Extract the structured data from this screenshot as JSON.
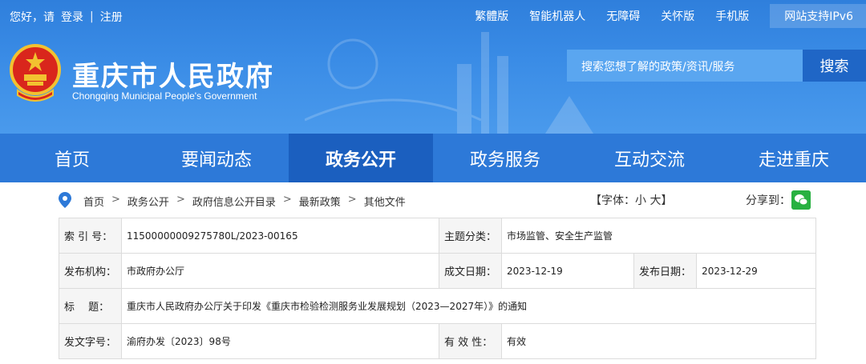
{
  "topbar": {
    "greeting": "您好，请",
    "login": "登录",
    "separator": "|",
    "register": "注册",
    "links": [
      "繁體版",
      "智能机器人",
      "无障碍",
      "关怀版",
      "手机版"
    ],
    "ipv6": "网站支持IPv6"
  },
  "header": {
    "title": "重庆市人民政府",
    "subtitle": "Chongqing Municipal People's Government",
    "search_placeholder": "搜索您想了解的政策/资讯/服务",
    "search_button": "搜索"
  },
  "nav": [
    {
      "label": "首页",
      "active": false
    },
    {
      "label": "要闻动态",
      "active": false
    },
    {
      "label": "政务公开",
      "active": true
    },
    {
      "label": "政务服务",
      "active": false
    },
    {
      "label": "互动交流",
      "active": false
    },
    {
      "label": "走进重庆",
      "active": false
    }
  ],
  "breadcrumb": [
    "首页",
    "政务公开",
    "政府信息公开目录",
    "最新政策",
    "其他文件"
  ],
  "breadcrumb_arrow": ">",
  "font_size": "【字体：小 大】",
  "share_label": "分享到：",
  "meta": {
    "index_label": "索 引 号：",
    "index_value": "11500000009275780L/2023-00165",
    "topic_label": "主题分类：",
    "topic_value": "市场监管、安全生产监管",
    "publisher_label": "发布机构：",
    "publisher_value": "市政府办公厅",
    "written_label": "成文日期：",
    "written_value": "2023-12-19",
    "published_label": "发布日期：",
    "published_value": "2023-12-29",
    "title_label": "标　 题：",
    "title_value": "重庆市人民政府办公厅关于印发《重庆市检验检测服务业发展规划（2023—2027年）》的通知",
    "docno_label": "发文字号：",
    "docno_value": "渝府办发〔2023〕98号",
    "validity_label": "有 效 性：",
    "validity_value": "有效"
  },
  "colors": {
    "banner": "#3a8ce6",
    "nav": "#2d79d8",
    "nav_active": "#1b5fbf",
    "search_button": "#1f66c6"
  }
}
